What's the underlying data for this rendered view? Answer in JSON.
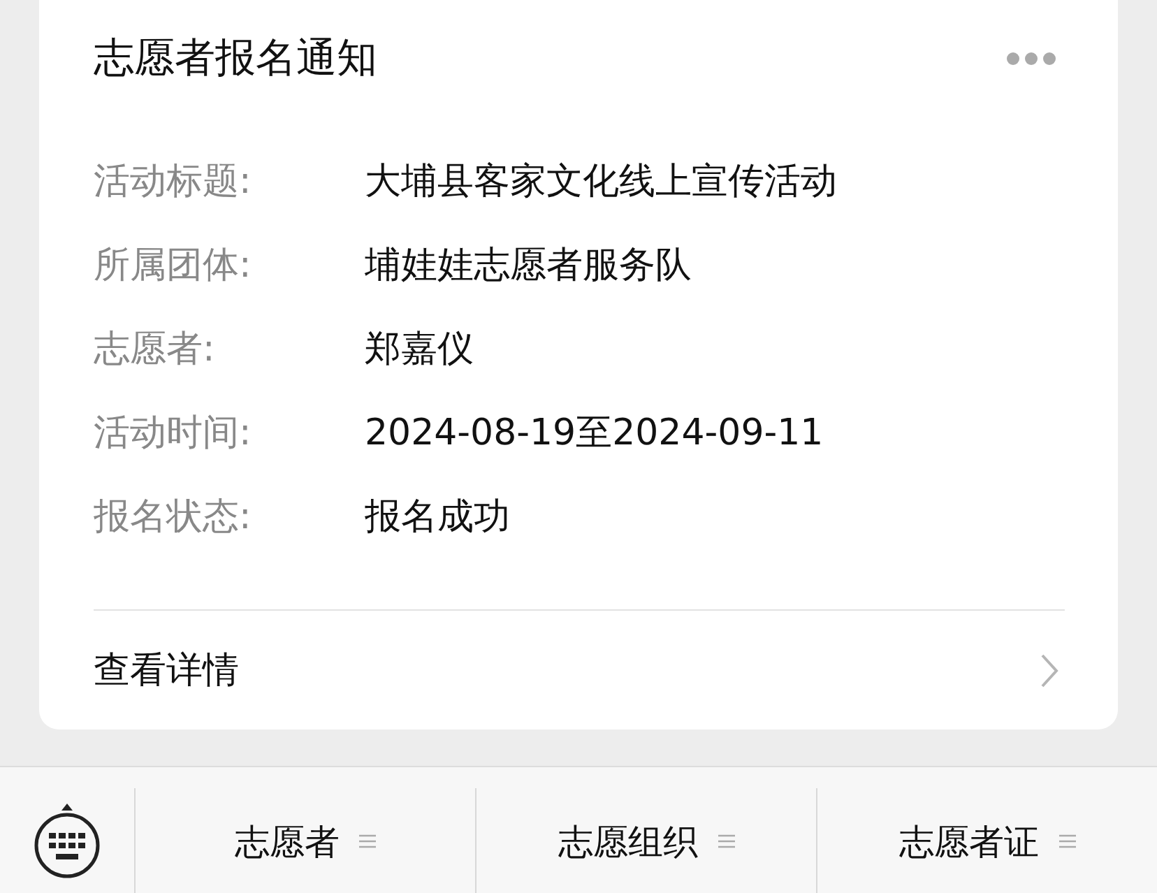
{
  "card": {
    "title": "志愿者报名通知",
    "fields": [
      {
        "label": "活动标题:",
        "value": "大埔县客家文化线上宣传活动"
      },
      {
        "label": "所属团体:",
        "value": "埔娃娃志愿者服务队"
      },
      {
        "label": "志愿者:",
        "value": "郑嘉仪"
      },
      {
        "label": "活动时间:",
        "value": "2024-08-19至2024-09-11"
      },
      {
        "label": "报名状态:",
        "value": "报名成功"
      }
    ],
    "detail_link": "查看详情"
  },
  "bottom_menu": [
    {
      "label": "志愿者"
    },
    {
      "label": "志愿组织"
    },
    {
      "label": "志愿者证"
    }
  ]
}
